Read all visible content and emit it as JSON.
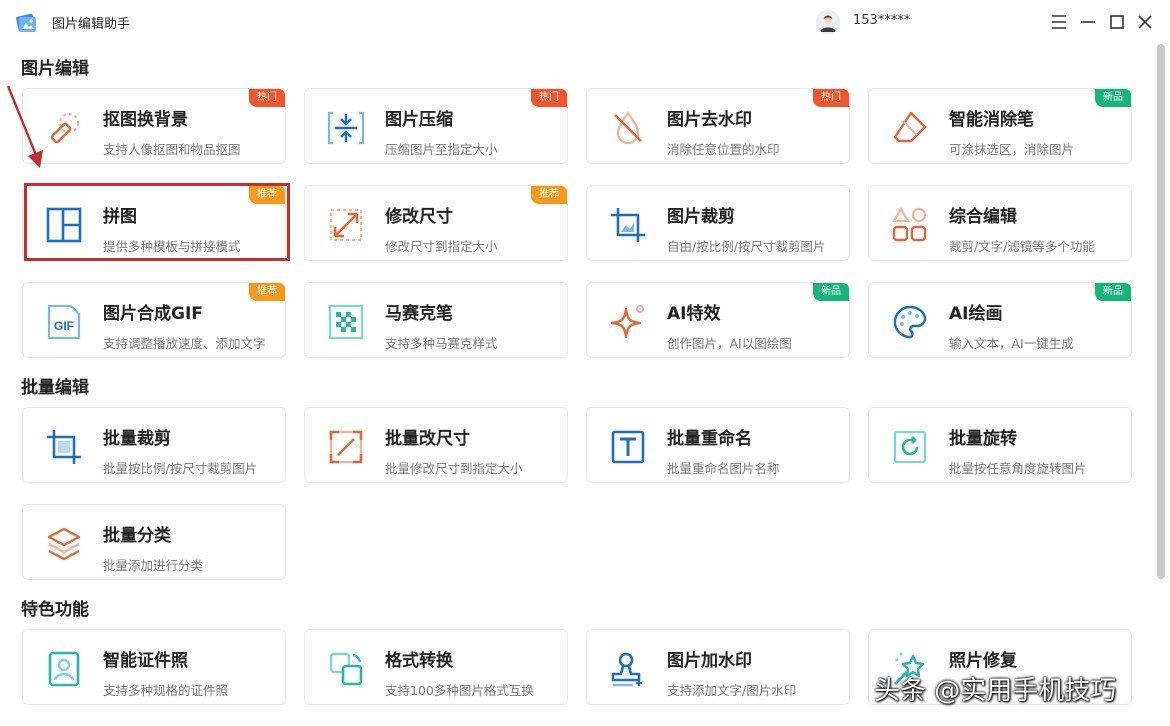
{
  "app": {
    "title": "图片编辑助手",
    "user": "153*****"
  },
  "sections": {
    "edit": "图片编辑",
    "batch": "批量编辑",
    "special": "特色功能"
  },
  "cards": {
    "matting": {
      "title": "抠图换背景",
      "desc": "支持人像抠图和物品抠图",
      "badge": "热门"
    },
    "compress": {
      "title": "图片压缩",
      "desc": "压缩图片至指定大小",
      "badge": "热门"
    },
    "watermark_remove": {
      "title": "图片去水印",
      "desc": "消除任意位置的水印",
      "badge": "热门"
    },
    "eraser": {
      "title": "智能消除笔",
      "desc": "可涂抹选区，消除图片",
      "badge": "新品"
    },
    "collage": {
      "title": "拼图",
      "desc": "提供多种模板与拼接模式",
      "badge": "推荐"
    },
    "resize": {
      "title": "修改尺寸",
      "desc": "修改尺寸到指定大小",
      "badge": "推荐"
    },
    "crop": {
      "title": "图片裁剪",
      "desc": "自由/按比例/按尺寸裁剪图片"
    },
    "composite": {
      "title": "综合编辑",
      "desc": "裁剪/文字/滤镜等多个功能"
    },
    "gif": {
      "title": "图片合成GIF",
      "desc": "支持调整播放速度、添加文字",
      "badge": "推荐"
    },
    "mosaic": {
      "title": "马赛克笔",
      "desc": "支持多种马赛克样式"
    },
    "ai_effect": {
      "title": "AI特效",
      "desc": "创作图片，AI以图绘图",
      "badge": "新品"
    },
    "ai_paint": {
      "title": "AI绘画",
      "desc": "输入文本，AI一键生成",
      "badge": "新品"
    },
    "batch_crop": {
      "title": "批量裁剪",
      "desc": "批量按比例/按尺寸裁剪图片"
    },
    "batch_resize": {
      "title": "批量改尺寸",
      "desc": "批量修改尺寸到指定大小"
    },
    "batch_rename": {
      "title": "批量重命名",
      "desc": "批量重命名图片名称"
    },
    "batch_rotate": {
      "title": "批量旋转",
      "desc": "批量按任意角度旋转图片"
    },
    "batch_classify": {
      "title": "批量分类",
      "desc": "批量添加进行分类"
    },
    "id_photo": {
      "title": "智能证件照",
      "desc": "支持多种规格的证件照"
    },
    "format": {
      "title": "格式转换",
      "desc": "支持100多种图片格式互换"
    },
    "add_watermark": {
      "title": "图片加水印",
      "desc": "支持添加文字/图片水印"
    },
    "repair": {
      "title": "照片修复",
      "desc": ""
    }
  },
  "watermark_text": "头条 @实用手机技巧",
  "colors": {
    "hot": "#f2552c",
    "recommend": "#f39a1d",
    "new": "#17b57a",
    "icon_blue": "#1e6fb8",
    "icon_orange": "#e0663c",
    "icon_teal": "#28b5a8",
    "highlight": "#c0302e"
  }
}
